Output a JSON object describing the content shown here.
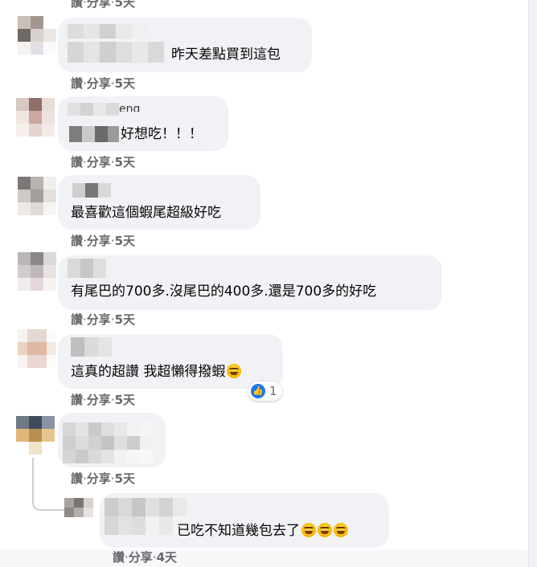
{
  "labels": {
    "like": "讚",
    "share": "分享",
    "sep": " · "
  },
  "comments": [
    {
      "text_suffix": "昨天差點買到這包",
      "time": "5天"
    },
    {
      "name_fragment": "eng",
      "text_suffix": "好想吃！！！",
      "time": "5天"
    },
    {
      "text": "最喜歡這個蝦尾超級好吃",
      "time": "5天"
    },
    {
      "text": "有尾巴的700多.沒尾巴的400多.還是700多的好吃",
      "time": "5天"
    },
    {
      "text": "這真的超讚 我超懶得撥蝦",
      "time": "5天",
      "reaction_count": "1"
    },
    {
      "time": "5天"
    }
  ],
  "reply": {
    "text": "已吃不知道幾包去了",
    "time": "4天"
  },
  "top_time": "5天",
  "icons": {
    "reaction": "like-thumb-icon",
    "emoji": "rolling-laughing-emoji-icon"
  },
  "colors": {
    "bubble": "#f0f2f5",
    "meta": "#65676b",
    "like_blue": "#1877f2"
  }
}
